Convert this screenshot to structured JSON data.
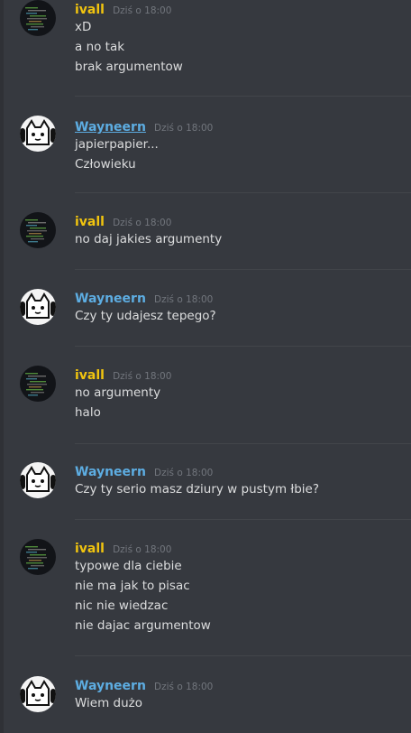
{
  "colors": {
    "background": "#36393f",
    "text": "#dcddde",
    "timestamp": "#72767d",
    "ivall": "#f1c40f",
    "wayneern": "#5dade2"
  },
  "users": {
    "ivall": {
      "name": "ivall",
      "avatar_icon": "code-screen-avatar"
    },
    "wayneern": {
      "name": "Wayneern",
      "avatar_icon": "cartoon-cat-avatar"
    }
  },
  "groups": [
    {
      "author": "ivall",
      "timestamp": "Dziś o 18:00",
      "lines": [
        "xD",
        "a no tak",
        "brak argumentow"
      ]
    },
    {
      "author": "Wayneern",
      "timestamp": "Dziś o 18:00",
      "lines": [
        "japierpapier...",
        "Człowieku"
      ]
    },
    {
      "author": "ivall",
      "timestamp": "Dziś o 18:00",
      "lines": [
        "no daj jakies argumenty"
      ]
    },
    {
      "author": "Wayneern",
      "timestamp": "Dziś o 18:00",
      "lines": [
        "Czy ty udajesz tepego?"
      ]
    },
    {
      "author": "ivall",
      "timestamp": "Dziś o 18:00",
      "lines": [
        "no argumenty",
        "halo"
      ]
    },
    {
      "author": "Wayneern",
      "timestamp": "Dziś o 18:00",
      "lines": [
        "Czy ty serio masz dziury w pustym łbie?"
      ]
    },
    {
      "author": "ivall",
      "timestamp": "Dziś o 18:00",
      "lines": [
        "typowe dla ciebie",
        "nie ma jak to pisac",
        "nic nie wiedzac",
        "nie dajac argumentow"
      ]
    },
    {
      "author": "Wayneern",
      "timestamp": "Dziś o 18:00",
      "lines": [
        "Wiem dużo"
      ]
    }
  ]
}
